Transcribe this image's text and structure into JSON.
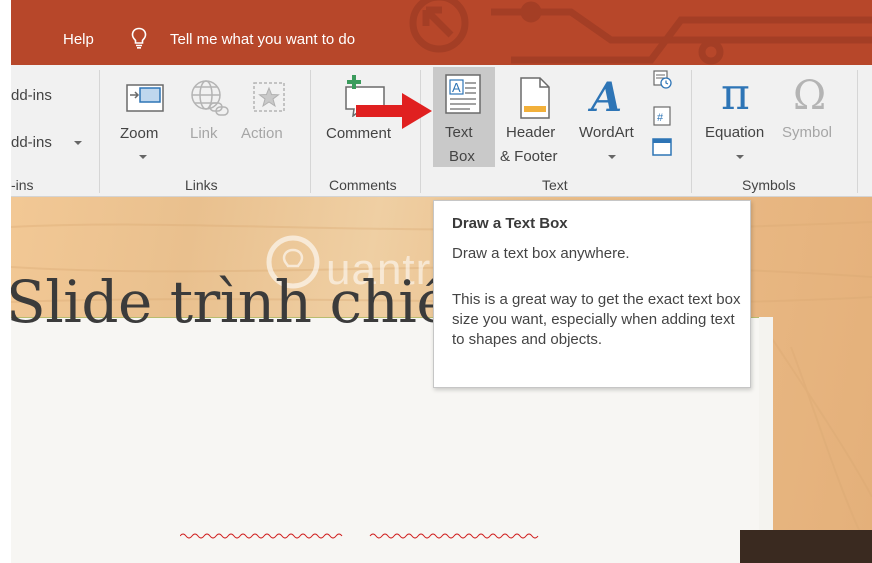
{
  "titlebar": {
    "help_label": "Help",
    "tell_me": "Tell me what you want to do"
  },
  "ribbon": {
    "addins": {
      "item1": "dd-ins",
      "item2": "dd-ins",
      "group_label": "-ins"
    },
    "links": {
      "zoom": "Zoom",
      "link": "Link",
      "action": "Action",
      "group_label": "Links"
    },
    "comments": {
      "comment": "Comment",
      "group_label": "Comments"
    },
    "text": {
      "textbox_line1": "Text",
      "textbox_line2": "Box",
      "header_line1": "Header",
      "header_line2": "& Footer",
      "wordart": "WordArt",
      "group_label": "Text"
    },
    "symbols": {
      "equation": "Equation",
      "symbol": "Symbol",
      "group_label": "Symbols"
    }
  },
  "tooltip": {
    "title": "Draw a Text Box",
    "line1": "Draw a text box anywhere.",
    "body": "This is a great way to get the exact text box size you want, especially when adding text to shapes and objects."
  },
  "slide": {
    "title": "Slide trình chiếu",
    "watermark": "uantrimang"
  },
  "colors": {
    "titlebar_bg": "#b7472a",
    "ribbon_bg": "#f1f1f1",
    "arrow": "#e02020",
    "accent_blue": "#2e75b6"
  }
}
